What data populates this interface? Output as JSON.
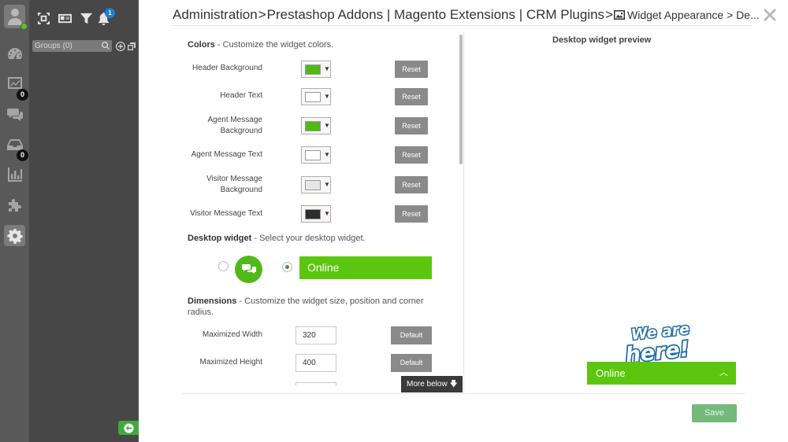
{
  "header": {
    "crumbs": [
      "Administration",
      "Prestashop Addons | Magento Extensions | CRM Plugins"
    ],
    "current_page": "Widget Appearance",
    "truncated_tail": "De..."
  },
  "left_rail": {
    "status_color": "#5ec518",
    "items": [
      {
        "icon": "dashboard-icon"
      },
      {
        "icon": "chart-line-icon",
        "badge": "0"
      },
      {
        "icon": "chat-icon"
      },
      {
        "icon": "inbox-icon",
        "badge": "0"
      },
      {
        "icon": "bar-chart-icon"
      },
      {
        "icon": "puzzle-icon"
      },
      {
        "icon": "gear-icon",
        "active": true
      }
    ]
  },
  "group_panel": {
    "notification_count": "1",
    "search_placeholder": "Groups (0)"
  },
  "colors_section": {
    "title": "Colors",
    "subtitle": " - Customize the widget colors.",
    "reset_label": "Reset",
    "rows": [
      {
        "label": "Header Background",
        "color": "#4fba14"
      },
      {
        "label": "Header Text",
        "color": "#ffffff"
      },
      {
        "label": "Agent Message Background",
        "color": "#4fba14"
      },
      {
        "label": "Agent Message Text",
        "color": "#ffffff"
      },
      {
        "label": "Visitor Message Background",
        "color": "#e6e6e6"
      },
      {
        "label": "Visitor Message Text",
        "color": "#2d2d2d"
      }
    ]
  },
  "desktop_widget": {
    "title": "Desktop widget",
    "subtitle": " - Select your desktop widget.",
    "bar_option_label": "Online",
    "selected": "bar"
  },
  "dimensions": {
    "title": "Dimensions",
    "subtitle": " - Customize the widget size, position and corner radius.",
    "default_label": "Default",
    "rows": [
      {
        "label": "Maximized Width",
        "value": "320"
      },
      {
        "label": "Maximized Height",
        "value": "400"
      }
    ]
  },
  "more_below_label": "More below",
  "preview": {
    "title": "Desktop widget preview",
    "logo_text": [
      "We are",
      "here!"
    ],
    "widget_label": "Online"
  },
  "save_label": "Save"
}
